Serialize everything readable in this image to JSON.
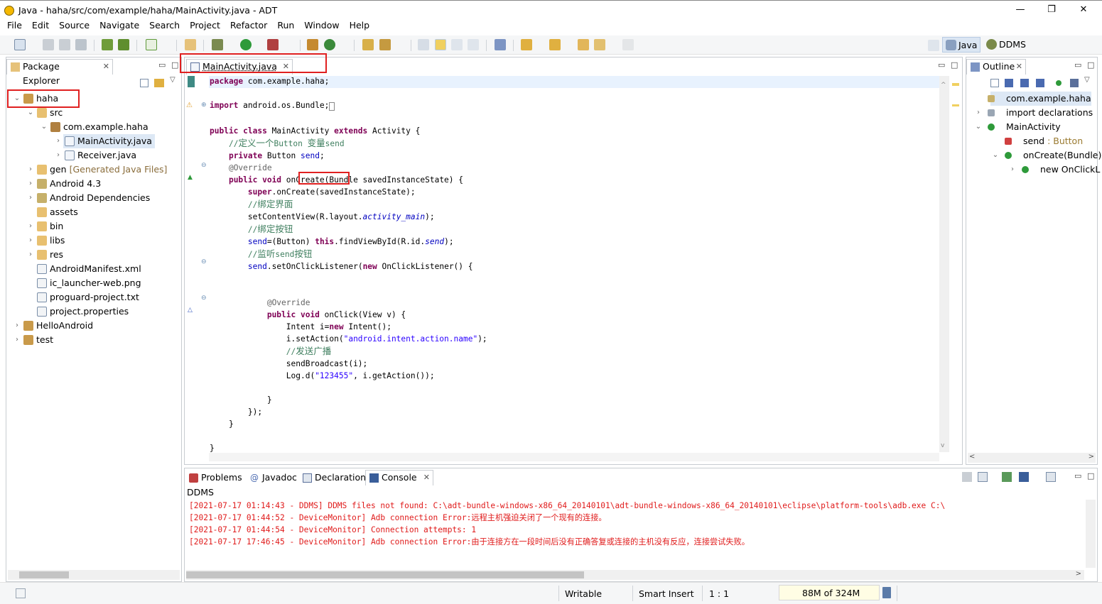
{
  "window": {
    "title": "Java - haha/src/com/example/haha/MainActivity.java - ADT",
    "minimize": "—",
    "maximize": "❐",
    "close": "✕"
  },
  "menu": [
    "File",
    "Edit",
    "Source",
    "Navigate",
    "Search",
    "Project",
    "Refactor",
    "Run",
    "Window",
    "Help"
  ],
  "perspectives": {
    "java": "Java",
    "ddms": "DDMS"
  },
  "package_explorer": {
    "tab_label": "Package Explorer",
    "items": [
      {
        "label": "haha",
        "level": 0,
        "expanded": true
      },
      {
        "label": "src",
        "level": 1,
        "expanded": true
      },
      {
        "label": "com.example.haha",
        "level": 2,
        "expanded": true
      },
      {
        "label": "MainActivity.java",
        "level": 3,
        "selected": true
      },
      {
        "label": "Receiver.java",
        "level": 3
      },
      {
        "label": "gen",
        "extra": "[Generated Java Files]",
        "level": 1
      },
      {
        "label": "Android 4.3",
        "level": 1
      },
      {
        "label": "Android Dependencies",
        "level": 1
      },
      {
        "label": "assets",
        "level": 1
      },
      {
        "label": "bin",
        "level": 1
      },
      {
        "label": "libs",
        "level": 1
      },
      {
        "label": "res",
        "level": 1
      },
      {
        "label": "AndroidManifest.xml",
        "level": 1
      },
      {
        "label": "ic_launcher-web.png",
        "level": 1
      },
      {
        "label": "proguard-project.txt",
        "level": 1
      },
      {
        "label": "project.properties",
        "level": 1
      },
      {
        "label": "HelloAndroid",
        "level": 0
      },
      {
        "label": "test",
        "level": 0
      }
    ]
  },
  "editor": {
    "tab_label": "MainActivity.java",
    "lines": [
      "package com.example.haha;",
      "",
      "import android.os.Bundle;",
      "",
      "public class MainActivity extends Activity {",
      "    //定义一个Button 变量send",
      "    private Button send;",
      "    @Override",
      "    public void onCreate(Bundle savedInstanceState) {",
      "        super.onCreate(savedInstanceState);",
      "        //绑定界面",
      "        setContentView(R.layout.activity_main);",
      "        //绑定按钮",
      "        send=(Button) this.findViewById(R.id.send);",
      "        //监听send按钮",
      "        send.setOnClickListener(new OnClickListener() {",
      "",
      "",
      "            @Override",
      "            public void onClick(View v) {",
      "                Intent i=new Intent();",
      "                i.setAction(\"android.intent.action.name\");",
      "                //发送广播",
      "                sendBroadcast(i);",
      "                Log.d(\"123455\", i.getAction());",
      "",
      "            }",
      "        });",
      "    }",
      "",
      "}"
    ]
  },
  "outline": {
    "tab_label": "Outline",
    "items": [
      {
        "label": "com.example.haha",
        "level": 0,
        "selected": true
      },
      {
        "label": "import declarations",
        "level": 0
      },
      {
        "label": "MainActivity",
        "level": 0
      },
      {
        "label": "send",
        "extra": ": Button",
        "level": 1
      },
      {
        "label": "onCreate(Bundle)",
        "level": 1
      },
      {
        "label": "new OnClickL",
        "level": 2
      }
    ]
  },
  "bottom_tabs": [
    "Problems",
    "Javadoc",
    "Declaration",
    "Console"
  ],
  "console": {
    "header": "DDMS",
    "lines": [
      "[2021-07-17 01:14:43 - DDMS] DDMS files not found: C:\\adt-bundle-windows-x86_64_20140101\\adt-bundle-windows-x86_64_20140101\\eclipse\\platform-tools\\adb.exe C:\\",
      "[2021-07-17 01:44:52 - DeviceMonitor] Adb connection Error:远程主机强迫关闭了一个现有的连接。",
      "[2021-07-17 01:44:54 - DeviceMonitor] Connection attempts: 1",
      "[2021-07-17 17:46:45 - DeviceMonitor] Adb connection Error:由于连接方在一段时间后没有正确答复或连接的主机没有反应，连接尝试失败。"
    ]
  },
  "status": {
    "writable": "Writable",
    "insert_mode": "Smart Insert",
    "position": "1 : 1",
    "memory": "88M of 324M"
  }
}
